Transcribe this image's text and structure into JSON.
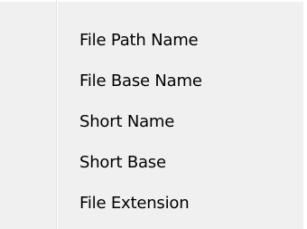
{
  "context_menu": {
    "items": [
      {
        "label": "File Path Name"
      },
      {
        "label": "File Base Name"
      },
      {
        "label": "Short Name"
      },
      {
        "label": "Short Base"
      },
      {
        "label": "File Extension"
      }
    ]
  },
  "colors": {
    "menu_background": "#f0f0f0",
    "gutter_separator": "#e3e3e3",
    "text": "#000000"
  }
}
